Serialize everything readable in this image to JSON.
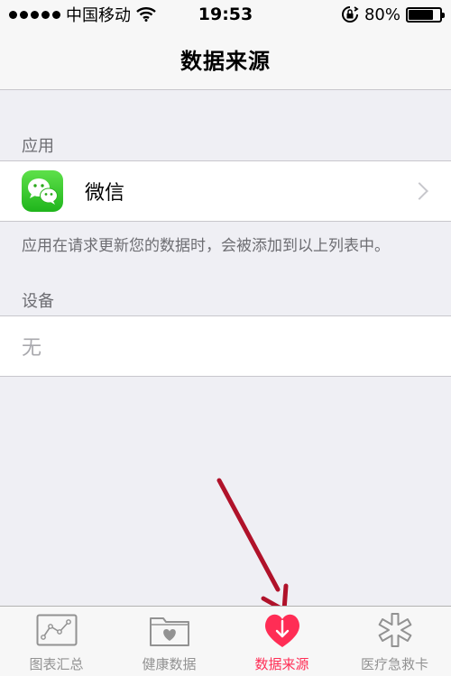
{
  "status_bar": {
    "carrier": "中国移动",
    "time": "19:53",
    "battery_percent": "80%",
    "battery_level": 0.8,
    "signal_icon": "signal-dots-icon",
    "wifi_icon": "wifi-icon",
    "rotation_lock_icon": "rotation-lock-icon"
  },
  "nav": {
    "title": "数据来源"
  },
  "apps_section": {
    "header": "应用",
    "items": [
      {
        "label": "微信",
        "icon": "wechat-icon"
      }
    ],
    "footer": "应用在请求更新您的数据时，会被添加到以上列表中。"
  },
  "devices_section": {
    "header": "设备",
    "empty_label": "无"
  },
  "tabs": [
    {
      "label": "图表汇总",
      "icon": "chart-icon",
      "active": false
    },
    {
      "label": "健康数据",
      "icon": "health-data-folder-icon",
      "active": false
    },
    {
      "label": "数据来源",
      "icon": "sources-heart-icon",
      "active": true
    },
    {
      "label": "医疗急救卡",
      "icon": "medical-star-icon",
      "active": false
    }
  ],
  "colors": {
    "accent": "#ff2d55",
    "annotation_arrow": "#b0122a",
    "wechat_green": "#2dc100"
  }
}
